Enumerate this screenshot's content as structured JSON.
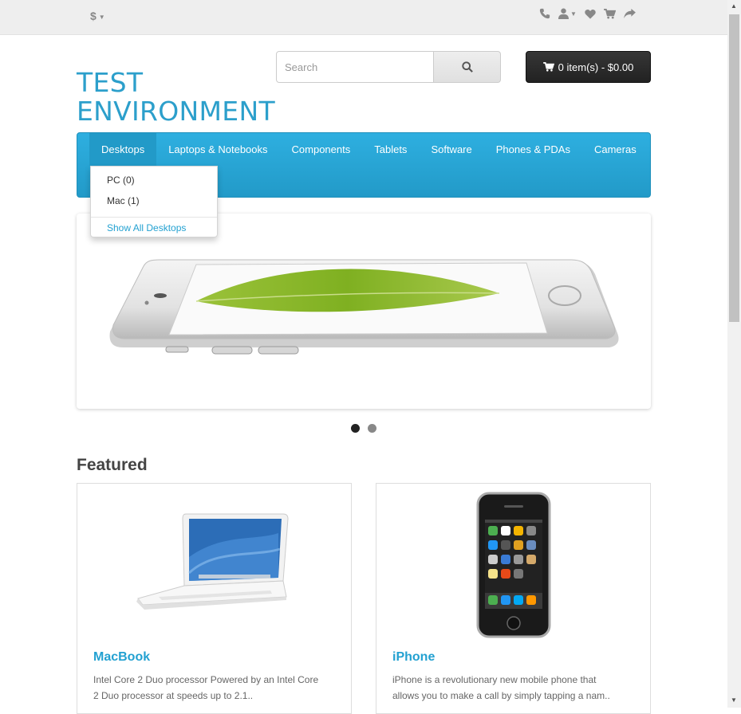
{
  "topbar": {
    "currency": "$",
    "icons": [
      "phone-icon",
      "user-icon",
      "heart-icon",
      "shopping-cart-icon",
      "share-icon"
    ]
  },
  "logo": {
    "line1": "TEST",
    "line2": "ENVIRONMENT"
  },
  "search": {
    "placeholder": "Search"
  },
  "cart": {
    "label": "0 item(s) - $0.00"
  },
  "menu": {
    "items": [
      "Desktops",
      "Laptops & Notebooks",
      "Components",
      "Tablets",
      "Software",
      "Phones & PDAs",
      "Cameras"
    ],
    "dropdown": {
      "items": [
        "PC (0)",
        "Mac (1)"
      ],
      "show_all": "Show All Desktops"
    }
  },
  "slideshow": {
    "active_slide": 1,
    "total_slides": 2
  },
  "featured": {
    "title": "Featured",
    "products": [
      {
        "name": "MacBook",
        "desc_line1": "Intel Core 2 Duo processor Powered by an Intel Core",
        "desc_line2": "2 Duo processor at speeds up to 2.1.."
      },
      {
        "name": "iPhone",
        "desc_line1": "iPhone is a revolutionary new mobile phone that",
        "desc_line2": "allows you to make a call by simply tapping a nam.."
      }
    ]
  },
  "colors": {
    "accent": "#23a1d1",
    "menu_bg": "#229ac8",
    "cart_bg": "#2a2a2a"
  }
}
